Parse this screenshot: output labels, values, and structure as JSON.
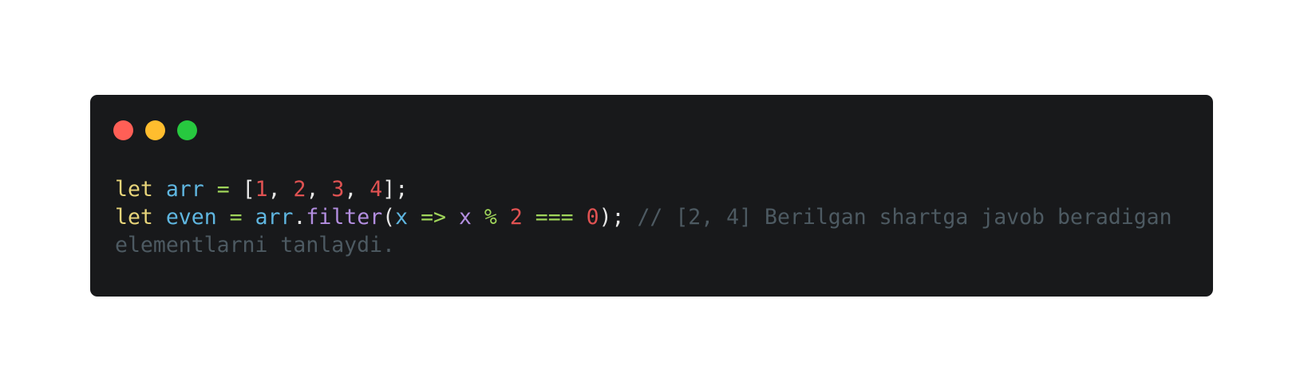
{
  "window": {
    "buttons": {
      "close_color": "#ff5f56",
      "minimize_color": "#ffbd2e",
      "maximize_color": "#27c93f"
    }
  },
  "code": {
    "line1": {
      "kw": "let",
      "var": "arr",
      "eq": "=",
      "open": "[",
      "n1": "1",
      "c1": ", ",
      "n2": "2",
      "c2": ", ",
      "n3": "3",
      "c3": ", ",
      "n4": "4",
      "close": "];"
    },
    "line2": {
      "kw": "let",
      "var": "even",
      "eq": "=",
      "obj": "arr",
      "dot": ".",
      "fn": "filter",
      "paren_open": "(",
      "param": "x",
      "arrow": "=>",
      "x2": "x",
      "mod": "%",
      "n2": "2",
      "strict_eq": "===",
      "n0": "0",
      "paren_close": ");",
      "comment": "// [2, 4] Berilgan shartga javob beradigan elementlarni tanlaydi."
    }
  }
}
